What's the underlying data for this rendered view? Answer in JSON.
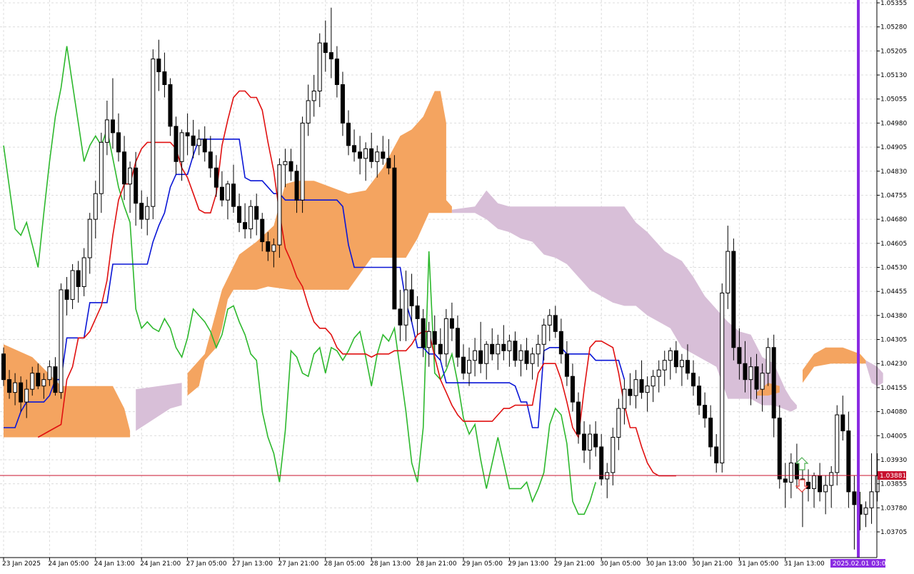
{
  "chart_data": {
    "type": "candlestick",
    "indicator": "Ichimoku Kinko Hyo",
    "grid": true,
    "y_axis": {
      "ylim": [
        1.0366,
        1.0535
      ],
      "tick_labels": [
        "1.05355",
        "1.05280",
        "1.05205",
        "1.05130",
        "1.05055",
        "1.04980",
        "1.04905",
        "1.04830",
        "1.04755",
        "1.04680",
        "1.04605",
        "1.04530",
        "1.04455",
        "1.04380",
        "1.04305",
        "1.04230",
        "1.04155",
        "1.04080",
        "1.04005",
        "1.03930",
        "1.03855",
        "1.03780",
        "1.03705"
      ]
    },
    "x_axis": {
      "tick_labels": [
        "23 Jan 2025",
        "24 Jan 05:00",
        "24 Jan 13:00",
        "24 Jan 21:00",
        "27 Jan 05:00",
        "27 Jan 13:00",
        "27 Jan 21:00",
        "28 Jan 05:00",
        "28 Jan 13:00",
        "28 Jan 21:00",
        "29 Jan 05:00",
        "29 Jan 13:00",
        "29 Jan 21:00",
        "30 Jan 05:00",
        "30 Jan 13:00",
        "30 Jan 21:00",
        "31 Jan 05:00",
        "31 Jan 13:00"
      ]
    },
    "current_price": {
      "value": 1.03881,
      "label": "1.03881",
      "color": "#c8102e"
    },
    "time_marker": {
      "label": "2025.02.01 03:00",
      "color": "#8a2be2"
    },
    "candles": [
      [
        1.0426,
        1.0428,
        1.0416,
        1.0418
      ],
      [
        1.0418,
        1.0421,
        1.0412,
        1.0414
      ],
      [
        1.0414,
        1.042,
        1.041,
        1.0417
      ],
      [
        1.0417,
        1.0419,
        1.0408,
        1.0411
      ],
      [
        1.0411,
        1.0418,
        1.0406,
        1.0415
      ],
      [
        1.0415,
        1.0422,
        1.0413,
        1.042
      ],
      [
        1.042,
        1.0423,
        1.0415,
        1.0416
      ],
      [
        1.0416,
        1.042,
        1.0412,
        1.0418
      ],
      [
        1.0418,
        1.0424,
        1.0416,
        1.0422
      ],
      [
        1.0422,
        1.0425,
        1.0413,
        1.0414
      ],
      [
        1.0414,
        1.0448,
        1.0412,
        1.0446
      ],
      [
        1.0446,
        1.045,
        1.0438,
        1.0443
      ],
      [
        1.0443,
        1.0454,
        1.044,
        1.0452
      ],
      [
        1.0452,
        1.0455,
        1.0442,
        1.0447
      ],
      [
        1.0447,
        1.0459,
        1.0444,
        1.0456
      ],
      [
        1.0456,
        1.047,
        1.0451,
        1.0468
      ],
      [
        1.0468,
        1.048,
        1.0462,
        1.0476
      ],
      [
        1.0476,
        1.0495,
        1.047,
        1.0492
      ],
      [
        1.0492,
        1.0505,
        1.0488,
        1.0499
      ],
      [
        1.0499,
        1.0512,
        1.049,
        1.0495
      ],
      [
        1.0495,
        1.0501,
        1.0486,
        1.0489
      ],
      [
        1.0489,
        1.0494,
        1.0474,
        1.0479
      ],
      [
        1.0479,
        1.0486,
        1.047,
        1.0484
      ],
      [
        1.0484,
        1.0489,
        1.0466,
        1.0473
      ],
      [
        1.0473,
        1.0477,
        1.0465,
        1.0468
      ],
      [
        1.0468,
        1.0475,
        1.0463,
        1.0472
      ],
      [
        1.0472,
        1.0521,
        1.0468,
        1.0518
      ],
      [
        1.0518,
        1.0524,
        1.0508,
        1.0514
      ],
      [
        1.0514,
        1.052,
        1.0506,
        1.051
      ],
      [
        1.051,
        1.0512,
        1.0494,
        1.0497
      ],
      [
        1.0497,
        1.05,
        1.0482,
        1.0486
      ],
      [
        1.0486,
        1.0496,
        1.048,
        1.0495
      ],
      [
        1.0495,
        1.0501,
        1.0488,
        1.0494
      ],
      [
        1.0494,
        1.0499,
        1.0487,
        1.0491
      ],
      [
        1.0491,
        1.0496,
        1.0488,
        1.0493
      ],
      [
        1.0493,
        1.0497,
        1.0486,
        1.0489
      ],
      [
        1.0489,
        1.0494,
        1.0481,
        1.0484
      ],
      [
        1.0484,
        1.0488,
        1.0475,
        1.0478
      ],
      [
        1.0478,
        1.0483,
        1.0472,
        1.0474
      ],
      [
        1.0474,
        1.048,
        1.0468,
        1.0479
      ],
      [
        1.0479,
        1.0485,
        1.047,
        1.0472
      ],
      [
        1.0472,
        1.0476,
        1.0464,
        1.0467
      ],
      [
        1.0467,
        1.0473,
        1.0462,
        1.0465
      ],
      [
        1.0465,
        1.0474,
        1.0462,
        1.0472
      ],
      [
        1.0472,
        1.0476,
        1.0463,
        1.0468
      ],
      [
        1.0468,
        1.047,
        1.0458,
        1.0461
      ],
      [
        1.0461,
        1.0464,
        1.0455,
        1.0458
      ],
      [
        1.0458,
        1.0462,
        1.0453,
        1.046
      ],
      [
        1.046,
        1.0487,
        1.0456,
        1.0485
      ],
      [
        1.0485,
        1.049,
        1.0478,
        1.0486
      ],
      [
        1.0486,
        1.049,
        1.048,
        1.0483
      ],
      [
        1.0483,
        1.0485,
        1.047,
        1.0474
      ],
      [
        1.0474,
        1.05,
        1.047,
        1.0498
      ],
      [
        1.0498,
        1.051,
        1.0494,
        1.0505
      ],
      [
        1.0505,
        1.0513,
        1.05,
        1.0508
      ],
      [
        1.0508,
        1.0526,
        1.0503,
        1.0523
      ],
      [
        1.0523,
        1.053,
        1.0514,
        1.052
      ],
      [
        1.052,
        1.0534,
        1.0512,
        1.0518
      ],
      [
        1.0518,
        1.0522,
        1.0506,
        1.051
      ],
      [
        1.051,
        1.0514,
        1.0494,
        1.0498
      ],
      [
        1.0498,
        1.0502,
        1.0488,
        1.0491
      ],
      [
        1.0491,
        1.0496,
        1.0486,
        1.0489
      ],
      [
        1.0489,
        1.0494,
        1.0482,
        1.0487
      ],
      [
        1.0487,
        1.0492,
        1.048,
        1.049
      ],
      [
        1.049,
        1.0495,
        1.0484,
        1.0486
      ],
      [
        1.0486,
        1.0491,
        1.0481,
        1.0489
      ],
      [
        1.0489,
        1.0494,
        1.0485,
        1.0487
      ],
      [
        1.0487,
        1.0493,
        1.0482,
        1.0484
      ],
      [
        1.0484,
        1.0488,
        1.0474,
        1.044
      ],
      [
        1.044,
        1.0446,
        1.043,
        1.0435
      ],
      [
        1.0435,
        1.0452,
        1.043,
        1.0446
      ],
      [
        1.0446,
        1.0451,
        1.0436,
        1.0441
      ],
      [
        1.0441,
        1.0444,
        1.0432,
        1.0437
      ],
      [
        1.0437,
        1.044,
        1.0425,
        1.0428
      ],
      [
        1.0428,
        1.0436,
        1.0422,
        1.0433
      ],
      [
        1.0433,
        1.0438,
        1.0426,
        1.0429
      ],
      [
        1.0429,
        1.0434,
        1.0424,
        1.0426
      ],
      [
        1.0426,
        1.044,
        1.0422,
        1.0437
      ],
      [
        1.0437,
        1.0442,
        1.043,
        1.0434
      ],
      [
        1.0434,
        1.0438,
        1.0422,
        1.0425
      ],
      [
        1.0425,
        1.0429,
        1.0418,
        1.042
      ],
      [
        1.042,
        1.0428,
        1.0416,
        1.0424
      ],
      [
        1.0424,
        1.0431,
        1.0419,
        1.0427
      ],
      [
        1.0427,
        1.0436,
        1.042,
        1.0423
      ],
      [
        1.0423,
        1.043,
        1.0418,
        1.0429
      ],
      [
        1.0429,
        1.0434,
        1.0424,
        1.0426
      ],
      [
        1.0426,
        1.0432,
        1.0421,
        1.0429
      ],
      [
        1.0429,
        1.0435,
        1.0424,
        1.0427
      ],
      [
        1.0427,
        1.0432,
        1.0422,
        1.043
      ],
      [
        1.043,
        1.0433,
        1.0422,
        1.0424
      ],
      [
        1.0424,
        1.0429,
        1.0419,
        1.0427
      ],
      [
        1.0427,
        1.0431,
        1.0421,
        1.0423
      ],
      [
        1.0423,
        1.0428,
        1.0418,
        1.0426
      ],
      [
        1.0426,
        1.0432,
        1.0422,
        1.0429
      ],
      [
        1.0429,
        1.0437,
        1.0424,
        1.0435
      ],
      [
        1.0435,
        1.044,
        1.043,
        1.0438
      ],
      [
        1.0438,
        1.0441,
        1.0431,
        1.0433
      ],
      [
        1.0433,
        1.0437,
        1.0423,
        1.0426
      ],
      [
        1.0426,
        1.043,
        1.0416,
        1.0419
      ],
      [
        1.0419,
        1.0423,
        1.0408,
        1.0411
      ],
      [
        1.0411,
        1.0414,
        1.0398,
        1.0401
      ],
      [
        1.0401,
        1.0405,
        1.0392,
        1.0396
      ],
      [
        1.0396,
        1.0404,
        1.039,
        1.0401
      ],
      [
        1.0401,
        1.0405,
        1.0394,
        1.0397
      ],
      [
        1.0397,
        1.0401,
        1.0385,
        1.0387
      ],
      [
        1.0387,
        1.0392,
        1.0381,
        1.0389
      ],
      [
        1.0389,
        1.0403,
        1.0385,
        1.04
      ],
      [
        1.04,
        1.0412,
        1.0396,
        1.0409
      ],
      [
        1.0409,
        1.0418,
        1.0404,
        1.0415
      ],
      [
        1.0415,
        1.042,
        1.041,
        1.0413
      ],
      [
        1.0413,
        1.0421,
        1.0409,
        1.0418
      ],
      [
        1.0418,
        1.0424,
        1.0412,
        1.0414
      ],
      [
        1.0414,
        1.0419,
        1.0408,
        1.0416
      ],
      [
        1.0416,
        1.0421,
        1.0411,
        1.0419
      ],
      [
        1.0419,
        1.0424,
        1.0414,
        1.0421
      ],
      [
        1.0421,
        1.0427,
        1.0416,
        1.0424
      ],
      [
        1.0424,
        1.0428,
        1.0418,
        1.0427
      ],
      [
        1.0427,
        1.043,
        1.042,
        1.0422
      ],
      [
        1.0422,
        1.0426,
        1.0416,
        1.0424
      ],
      [
        1.0424,
        1.0429,
        1.0418,
        1.042
      ],
      [
        1.042,
        1.0424,
        1.0413,
        1.0416
      ],
      [
        1.0416,
        1.0419,
        1.0407,
        1.041
      ],
      [
        1.041,
        1.0414,
        1.0403,
        1.0406
      ],
      [
        1.0406,
        1.041,
        1.0394,
        1.0397
      ],
      [
        1.0397,
        1.0401,
        1.0389,
        1.0392
      ],
      [
        1.0392,
        1.0448,
        1.0389,
        1.0445
      ],
      [
        1.0445,
        1.0466,
        1.044,
        1.0458
      ],
      [
        1.0458,
        1.0462,
        1.0424,
        1.0428
      ],
      [
        1.0428,
        1.0434,
        1.0418,
        1.0423
      ],
      [
        1.0423,
        1.043,
        1.0414,
        1.0418
      ],
      [
        1.0418,
        1.0425,
        1.041,
        1.0422
      ],
      [
        1.0422,
        1.0426,
        1.0412,
        1.0415
      ],
      [
        1.0415,
        1.0423,
        1.0408,
        1.042
      ],
      [
        1.042,
        1.0431,
        1.0416,
        1.0428
      ],
      [
        1.0428,
        1.0432,
        1.04,
        1.0406
      ],
      [
        1.0406,
        1.041,
        1.0384,
        1.0387
      ],
      [
        1.0387,
        1.0392,
        1.0378,
        1.0386
      ],
      [
        1.0386,
        1.0395,
        1.0381,
        1.0392
      ],
      [
        1.0392,
        1.0398,
        1.0384,
        1.0387
      ],
      [
        1.0387,
        1.0392,
        1.0372,
        1.0386
      ],
      [
        1.0386,
        1.039,
        1.038,
        1.0384
      ],
      [
        1.0384,
        1.0389,
        1.0378,
        1.0388
      ],
      [
        1.0388,
        1.0392,
        1.038,
        1.0383
      ],
      [
        1.0383,
        1.0388,
        1.0376,
        1.0385
      ],
      [
        1.0385,
        1.0391,
        1.0378,
        1.0389
      ],
      [
        1.0389,
        1.041,
        1.0385,
        1.0407
      ],
      [
        1.0407,
        1.0413,
        1.0399,
        1.0402
      ],
      [
        1.0402,
        1.0408,
        1.0378,
        1.0383
      ],
      [
        1.0383,
        1.0388,
        1.0365,
        1.0379
      ],
      [
        1.0379,
        1.0383,
        1.0371,
        1.0376
      ],
      [
        1.0376,
        1.038,
        1.0372,
        1.0378
      ],
      [
        1.0378,
        1.0395,
        1.0373,
        1.0383
      ],
      [
        1.0383,
        1.0395,
        1.038,
        1.0388
      ]
    ],
    "tenkan_sen": [
      1.04,
      1.0401,
      1.0402,
      1.0403,
      1.0404,
      1.0418,
      1.0422,
      1.0431,
      1.0431,
      1.0433,
      1.0437,
      1.0441,
      1.0449,
      1.0463,
      1.0474,
      1.0479,
      1.0479,
      1.0486,
      1.049,
      1.0492,
      1.0492,
      1.0492,
      1.0492,
      1.0492,
      1.049,
      1.0484,
      1.0481,
      1.0476,
      1.0471,
      1.047,
      1.047,
      1.0476,
      1.0491,
      1.0499,
      1.0506,
      1.0508,
      1.0508,
      1.0506,
      1.0506,
      1.0502,
      1.0492,
      1.0483,
      1.047,
      1.0459,
      1.0455,
      1.045,
      1.0447,
      1.0441,
      1.0436,
      1.0434,
      1.0434,
      1.0432,
      1.0428,
      1.0426,
      1.0426,
      1.0426,
      1.0426,
      1.0426,
      1.0425,
      1.0426,
      1.0426,
      1.0426,
      1.0427,
      1.0427,
      1.0427,
      1.0429,
      1.0432,
      1.0433,
      1.0433,
      1.0425,
      1.0418,
      1.0414,
      1.041,
      1.0407,
      1.0405,
      1.0405,
      1.0405,
      1.0405,
      1.0405,
      1.0405,
      1.0407,
      1.0409,
      1.0409,
      1.041,
      1.041,
      1.041,
      1.041,
      1.042,
      1.0423,
      1.0423,
      1.0423,
      1.0418,
      1.0411,
      1.0403,
      1.04,
      1.0415,
      1.0428,
      1.043,
      1.043,
      1.0429,
      1.0428,
      1.042,
      1.041,
      1.0403,
      1.0403,
      1.0397,
      1.0392,
      1.0389,
      1.0388,
      1.0388,
      1.0388,
      1.0388
    ],
    "kijun_sen": [
      1.0403,
      1.0403,
      1.0403,
      1.0408,
      1.0411,
      1.0411,
      1.0411,
      1.0411,
      1.0413,
      1.0418,
      1.0418,
      1.0431,
      1.0431,
      1.0431,
      1.0431,
      1.0442,
      1.0442,
      1.0442,
      1.0442,
      1.0454,
      1.0454,
      1.0454,
      1.0454,
      1.0454,
      1.0454,
      1.0454,
      1.0461,
      1.0466,
      1.047,
      1.0478,
      1.0482,
      1.0482,
      1.0482,
      1.0488,
      1.0493,
      1.0493,
      1.0493,
      1.0493,
      1.0493,
      1.0493,
      1.0493,
      1.0493,
      1.0481,
      1.048,
      1.048,
      1.048,
      1.0478,
      1.0476,
      1.0476,
      1.0474,
      1.0474,
      1.0474,
      1.0474,
      1.0474,
      1.0474,
      1.0474,
      1.0474,
      1.0474,
      1.0474,
      1.0472,
      1.046,
      1.0453,
      1.0453,
      1.0453,
      1.0453,
      1.0453,
      1.0453,
      1.0453,
      1.0453,
      1.0453,
      1.0442,
      1.0436,
      1.0428,
      1.0428,
      1.0426,
      1.0426,
      1.0424,
      1.0417,
      1.0417,
      1.0417,
      1.0417,
      1.0417,
      1.0417,
      1.0417,
      1.0417,
      1.0417,
      1.0417,
      1.0417,
      1.0417,
      1.0416,
      1.0411,
      1.0411,
      1.0403,
      1.0403,
      1.0427,
      1.0428,
      1.0428,
      1.0428,
      1.0426,
      1.0426,
      1.0426,
      1.0426,
      1.0426,
      1.0424,
      1.0424,
      1.0424,
      1.0424,
      1.0424,
      1.0418
    ],
    "chikou_span": [
      1.0491,
      1.0478,
      1.0465,
      1.0463,
      1.0467,
      1.046,
      1.0453,
      1.047,
      1.0486,
      1.05,
      1.0509,
      1.0522,
      1.051,
      1.0498,
      1.0486,
      1.0491,
      1.0494,
      1.0491,
      1.0496,
      1.0487,
      1.0478,
      1.0472,
      1.0467,
      1.044,
      1.0434,
      1.0436,
      1.0434,
      1.0433,
      1.0437,
      1.0434,
      1.0428,
      1.0425,
      1.0431,
      1.044,
      1.0438,
      1.0436,
      1.0433,
      1.0428,
      1.0432,
      1.044,
      1.0441,
      1.0436,
      1.0432,
      1.0426,
      1.0424,
      1.0408,
      1.04,
      1.0395,
      1.0386,
      1.0402,
      1.0427,
      1.0425,
      1.042,
      1.0419,
      1.0426,
      1.0428,
      1.042,
      1.0428,
      1.0427,
      1.0424,
      1.0427,
      1.0431,
      1.0433,
      1.0425,
      1.0416,
      1.0426,
      1.0432,
      1.043,
      1.0434,
      1.0421,
      1.0408,
      1.0392,
      1.0386,
      1.0403,
      1.0458,
      1.042,
      1.0418,
      1.0421,
      1.0426,
      1.0417,
      1.0406,
      1.0401,
      1.0404,
      1.0393,
      1.0384,
      1.0392,
      1.04,
      1.0392,
      1.0384,
      1.0384,
      1.0384,
      1.0386,
      1.038,
      1.0384,
      1.0389,
      1.0404,
      1.0409,
      1.0407,
      1.0398,
      1.038,
      1.0376,
      1.0376,
      1.038,
      1.0386
    ]
  }
}
